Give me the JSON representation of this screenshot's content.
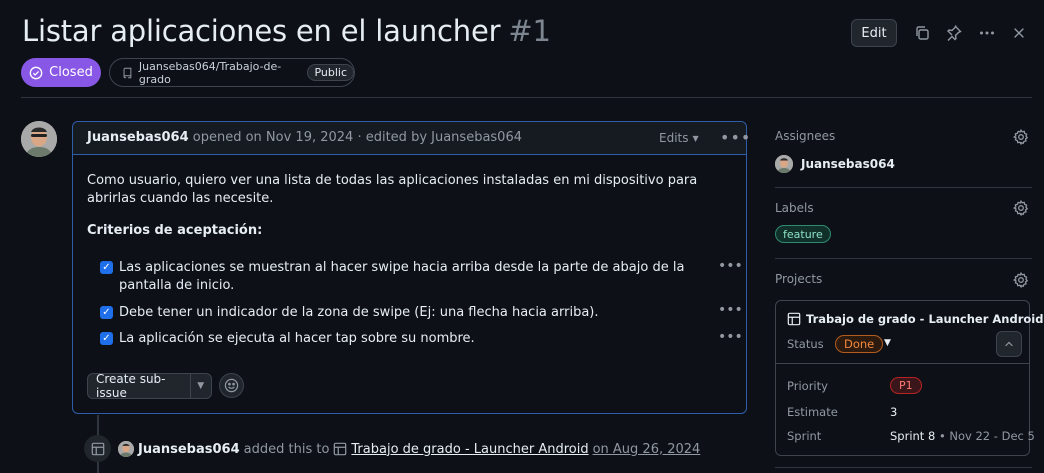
{
  "issue": {
    "title": "Listar aplicaciones en el launcher",
    "number": "#1",
    "state": "Closed",
    "repo": "Juansebas064/Trabajo-de-grado",
    "visibility": "Public",
    "edit_label": "Edit"
  },
  "comment": {
    "author": "Juansebas064",
    "meta": "opened on Nov 19, 2024 · edited by Juansebas064",
    "edits_label": "Edits",
    "body": "Como usuario, quiero ver una lista de todas las aplicaciones instaladas en mi dispositivo para abrirlas cuando las necesite.",
    "criteria_heading": "Criterios de aceptación:",
    "tasks": [
      {
        "text": "Las aplicaciones se muestran al hacer swipe hacia arriba desde la parte de abajo de la pantalla de inicio.",
        "checked": true
      },
      {
        "text": "Debe tener un indicador de la zona de swipe (Ej: una flecha hacia arriba).",
        "checked": true
      },
      {
        "text": "La aplicación se ejecuta al hacer tap sobre su nombre.",
        "checked": true
      }
    ],
    "sub_issue_label": "Create sub-issue"
  },
  "timeline": {
    "actor": "Juansebas064",
    "action": "added this to",
    "project": "Trabajo de grado - Launcher Android",
    "date": "on Aug 26, 2024"
  },
  "sidebar": {
    "assignees_label": "Assignees",
    "assignee": "Juansebas064",
    "labels_label": "Labels",
    "label": "feature",
    "projects_label": "Projects",
    "project": {
      "title": "Trabajo de grado - Launcher Android",
      "status_label": "Status",
      "status": "Done",
      "priority_label": "Priority",
      "priority": "P1",
      "estimate_label": "Estimate",
      "estimate": "3",
      "sprint_label": "Sprint",
      "sprint": "Sprint 8",
      "sprint_range": "• Nov 22 - Dec 5"
    }
  },
  "colors": {
    "background": "#0d1117",
    "closed_badge": "#8957e5",
    "accent_blue": "#1f6feb",
    "label_feature": "#2e8b72",
    "status_done": "#f0883e",
    "priority_p1": "#ff7b72"
  }
}
